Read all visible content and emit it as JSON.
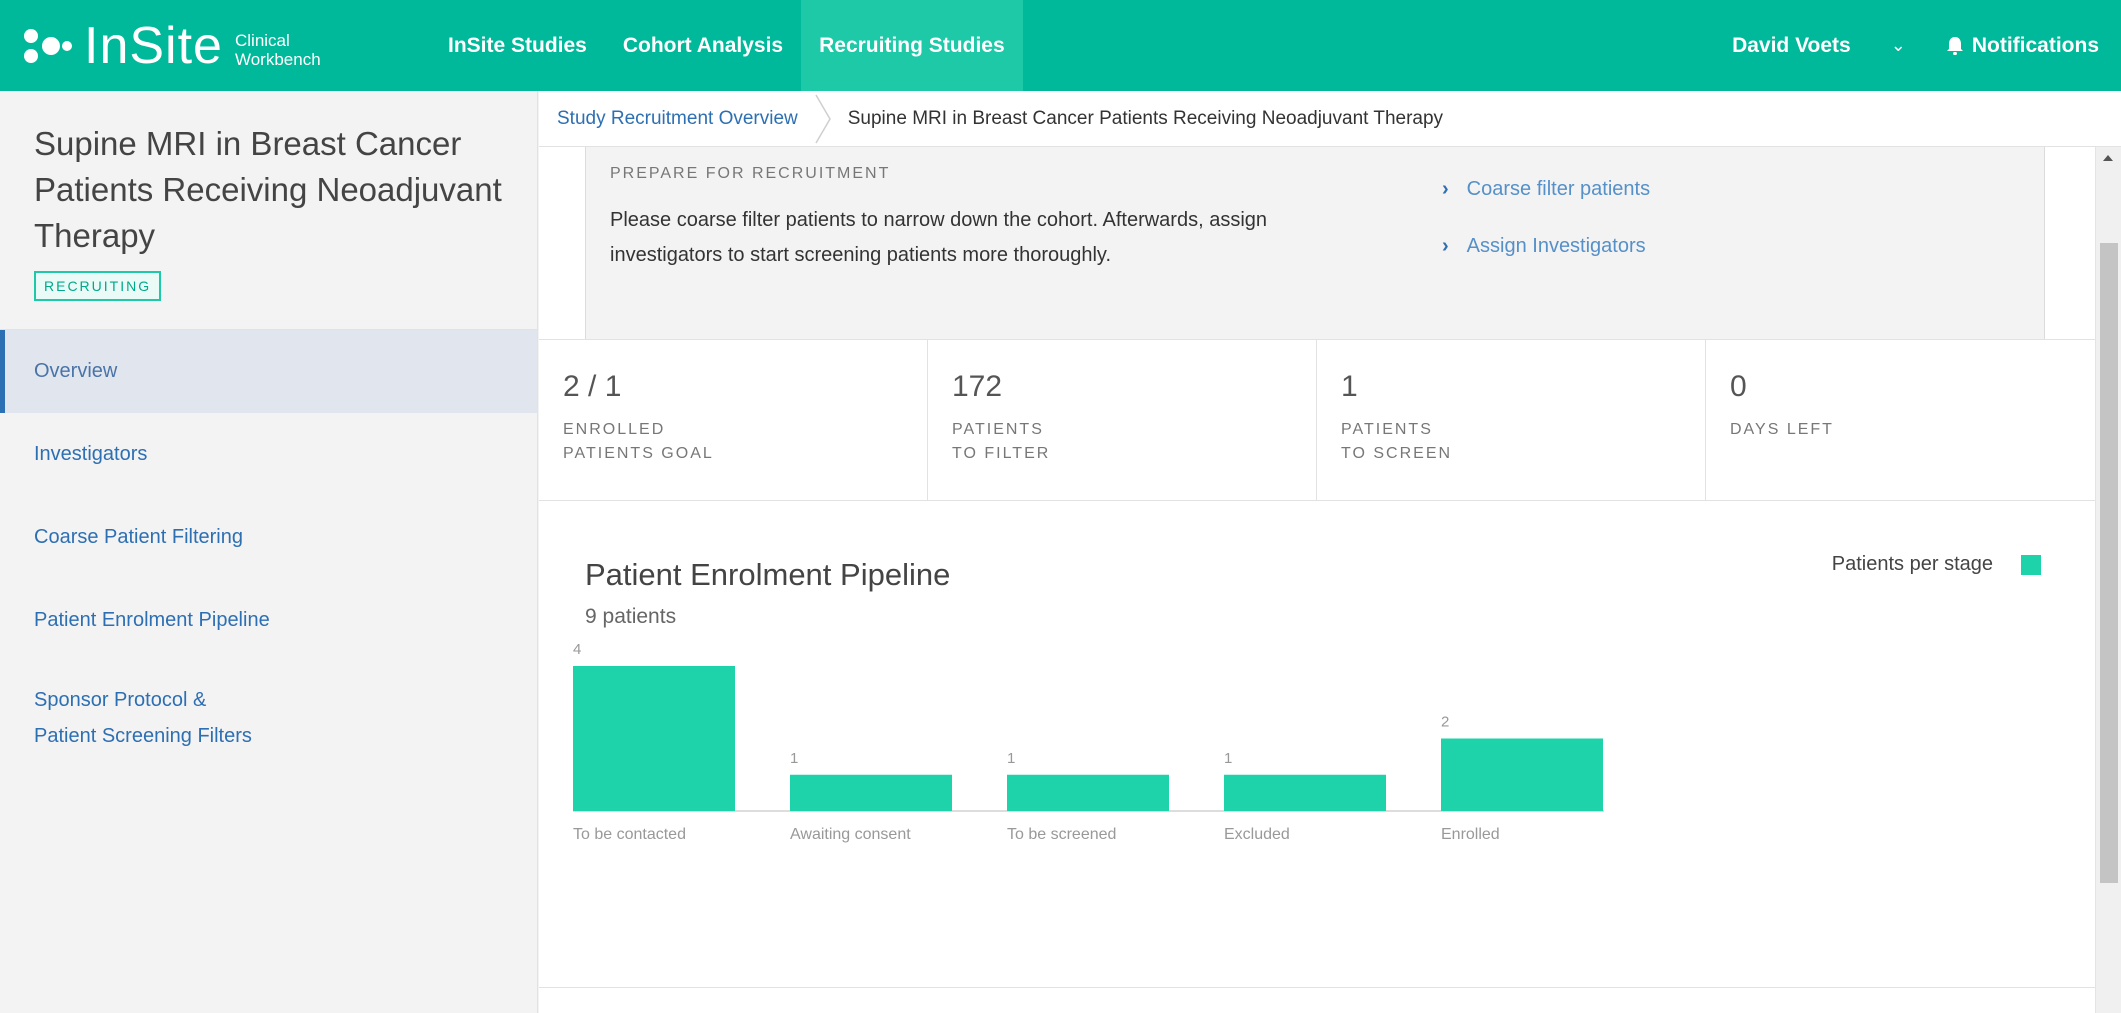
{
  "app": {
    "logo_main": "InSite",
    "logo_sub_1": "Clinical",
    "logo_sub_2": "Workbench"
  },
  "nav": {
    "items": [
      {
        "label": "InSite Studies",
        "active": false
      },
      {
        "label": "Cohort Analysis",
        "active": false
      },
      {
        "label": "Recruiting Studies",
        "active": true
      }
    ],
    "user": "David Voets",
    "notifications": "Notifications"
  },
  "study": {
    "title": "Supine MRI in Breast Cancer Patients Receiving Neoadjuvant Therapy",
    "status": "RECRUITING"
  },
  "sidebar": {
    "items": [
      {
        "label": "Overview",
        "active": true
      },
      {
        "label": "Investigators"
      },
      {
        "label": "Coarse Patient Filtering"
      },
      {
        "label": "Patient Enrolment Pipeline"
      },
      {
        "label_1": "Sponsor Protocol &",
        "label_2": "Patient Screening Filters"
      }
    ]
  },
  "breadcrumb": {
    "parent": "Study Recruitment Overview",
    "current": "Supine MRI in Breast Cancer Patients Receiving Neoadjuvant Therapy"
  },
  "prepare": {
    "label": "PREPARE FOR RECRUITMENT",
    "text": "Please coarse filter patients to narrow down the cohort. Afterwards, assign investigators to start screening patients more thoroughly.",
    "links": [
      "Coarse filter patients",
      "Assign Investigators"
    ]
  },
  "stats": [
    {
      "value": "2 / 1",
      "label_1": "ENROLLED",
      "label_2": "PATIENTS GOAL"
    },
    {
      "value": "172",
      "label_1": "PATIENTS",
      "label_2": "TO FILTER"
    },
    {
      "value": "1",
      "label_1": "PATIENTS",
      "label_2": "TO SCREEN"
    },
    {
      "value": "0",
      "label_1": "DAYS LEFT",
      "label_2": ""
    }
  ],
  "chart_data": {
    "type": "bar",
    "title": "Patient Enrolment Pipeline",
    "subtitle": "9 patients",
    "categories": [
      "To be contacted",
      "Awaiting consent",
      "To be screened",
      "Excluded",
      "Enrolled"
    ],
    "series": [
      {
        "name": "Patients per stage",
        "values": [
          4,
          1,
          1,
          1,
          2
        ]
      }
    ],
    "ylim": [
      0,
      4
    ],
    "color": "#1ed2aa",
    "legend": "top-right",
    "grid": false
  },
  "colors": {
    "brand": "#00b99a",
    "nav_active": "#1ec9a8",
    "link": "#2d6fb3",
    "bar": "#1ed2aa"
  },
  "icons": {
    "notifications": "bell-icon",
    "user_menu": "chevron-down-icon",
    "link_arrow": "chevron-right-icon"
  }
}
